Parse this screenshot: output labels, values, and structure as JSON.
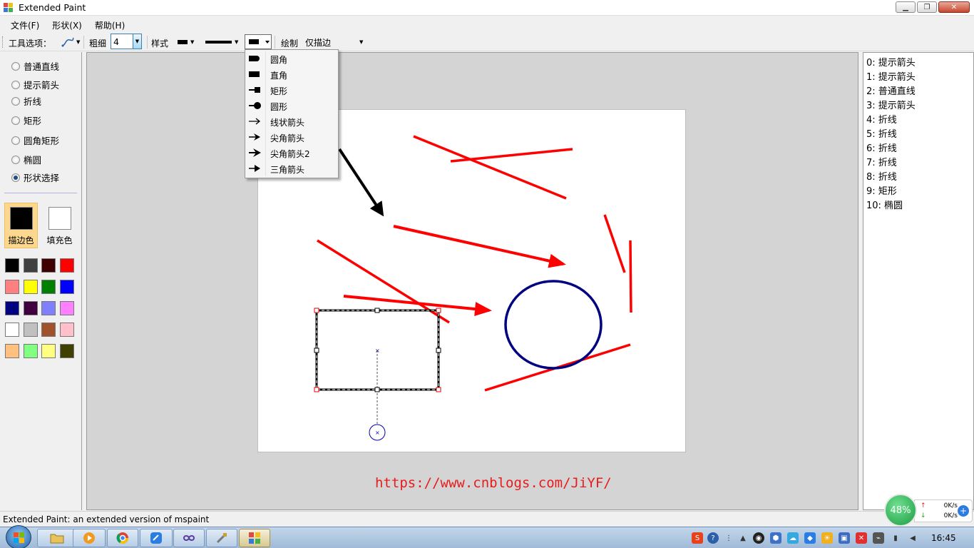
{
  "window": {
    "title": "Extended Paint",
    "min_symbol": "▁",
    "max_symbol": "❐",
    "close_symbol": "✕"
  },
  "menu": [
    {
      "label": "文件(F)"
    },
    {
      "label": "形状(X)"
    },
    {
      "label": "帮助(H)"
    }
  ],
  "toolbar": {
    "tool_options_label": "工具选项：",
    "thickness_label": "粗细",
    "thickness_value": "4",
    "style_label": "样式",
    "draw_label": "绘制",
    "draw_mode": "仅描边"
  },
  "dropdown": {
    "items": [
      {
        "label": "圆角",
        "icon": "round-cap-icon"
      },
      {
        "label": "直角",
        "icon": "flat-cap-icon"
      },
      {
        "label": "矩形",
        "icon": "square-anchor-icon"
      },
      {
        "label": "圆形",
        "icon": "round-anchor-icon"
      },
      {
        "label": "线状箭头",
        "icon": "line-arrow-icon"
      },
      {
        "label": "尖角箭头",
        "icon": "sharp-arrow-icon"
      },
      {
        "label": "尖角箭头2",
        "icon": "sharp-arrow2-icon"
      },
      {
        "label": "三角箭头",
        "icon": "triangle-arrow-icon"
      }
    ]
  },
  "shapes_tools": [
    {
      "label": "普通直线",
      "checked": false
    },
    {
      "label": "提示箭头",
      "checked": false
    },
    {
      "label": "折线",
      "checked": false
    },
    {
      "label": "矩形",
      "checked": false
    },
    {
      "label": "圆角矩形",
      "checked": false
    },
    {
      "label": "椭圆",
      "checked": false
    },
    {
      "label": "形状选择",
      "checked": true
    }
  ],
  "colors": {
    "stroke_label": "描边色",
    "stroke_color": "#000000",
    "fill_label": "填充色",
    "fill_color": "#ffffff",
    "palette": [
      "#000000",
      "#404040",
      "#400000",
      "#ff0000",
      "#ff8080",
      "#ffff00",
      "#008000",
      "#0000ff",
      "#000080",
      "#400040",
      "#8080ff",
      "#ff80ff",
      "#ffffff",
      "#c0c0c0",
      "#a0522d",
      "#ffc0cb",
      "#ffc080",
      "#80ff80",
      "#ffff80",
      "#404000"
    ]
  },
  "shape_list": [
    "0: 提示箭头",
    "1: 提示箭头",
    "2: 普通直线",
    "3: 提示箭头",
    "4: 折线",
    "5: 折线",
    "6: 折线",
    "7: 折线",
    "8: 折线",
    "9: 矩形",
    "10: 椭圆"
  ],
  "watermark": "https://www.cnblogs.com/JiYF/",
  "status": "Extended Paint: an extended version of mspaint",
  "net_widget": {
    "percent": "48%",
    "up": "0K/s",
    "down": "0K/s"
  },
  "taskbar": {
    "clock": "16:45"
  },
  "accent_colors": {
    "red": "#ff0000",
    "navy": "#000080",
    "selection": "#fcd88e"
  }
}
